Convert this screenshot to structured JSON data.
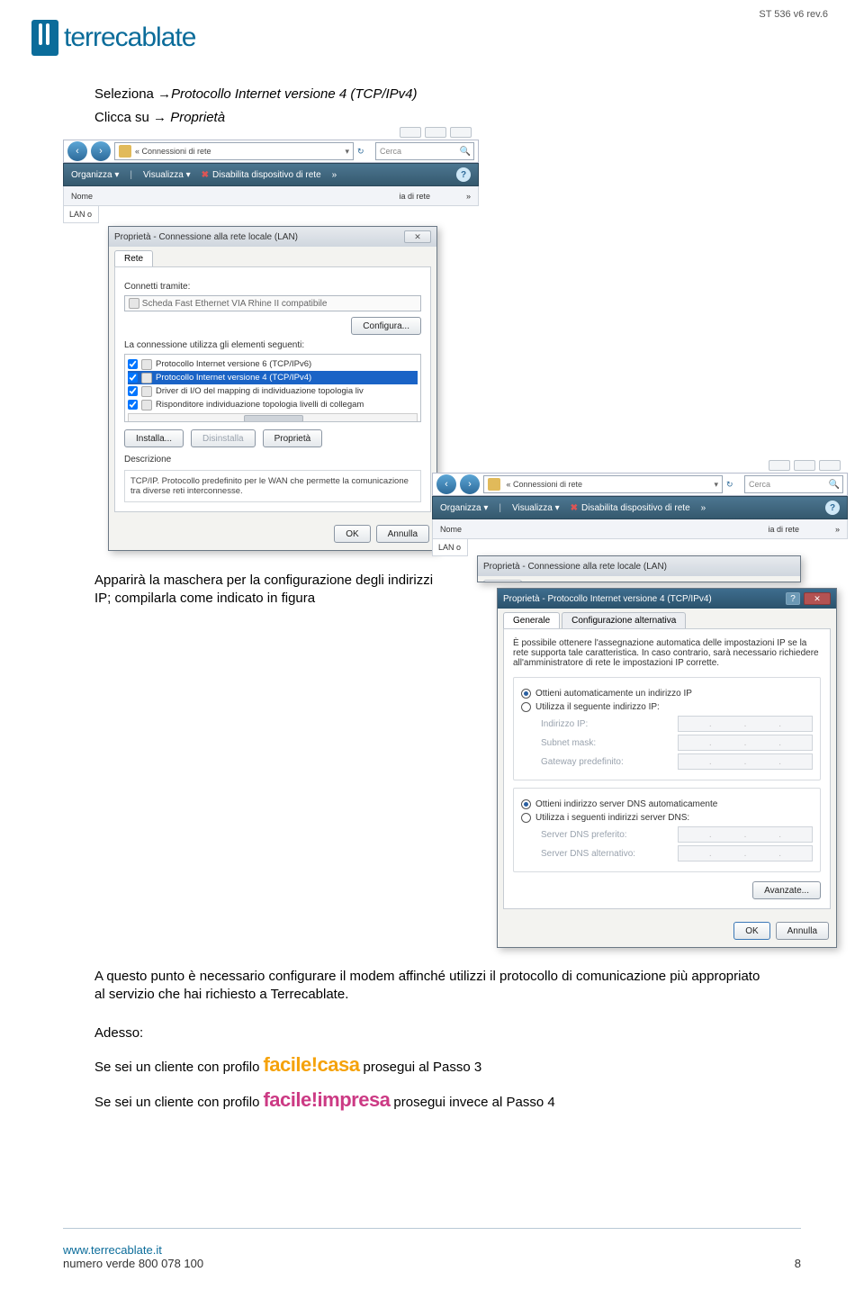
{
  "doc_id": "ST 536 v6 rev.6",
  "logo_text": "terrecablate",
  "instr1_a": "Seleziona ",
  "instr1_arrow": "→",
  "instr1_b": "Protocollo Internet versione 4 (TCP/IPv4)",
  "instr1_c": "Clicca su ",
  "instr1_d": " Proprietà",
  "para2": "Apparirà la maschera per la configurazione degli indirizzi IP; compilarla come indicato in figura",
  "para3": "A questo punto è necessario configurare il modem affinché utilizzi il protocollo di comunicazione più appropriato al servizio che hai richiesto a Terrecablate.",
  "adesso_hdr": "Adesso:",
  "prof1_a": "Se sei un cliente con profilo ",
  "prof1_brand": "facile!casa",
  "prof1_b": " prosegui al Passo 3",
  "prof2_a": "Se sei un cliente con profilo ",
  "prof2_brand": "facile!impresa",
  "prof2_b": " prosegui invece al Passo 4",
  "footer_link": "www.terrecablate.it",
  "footer_tel": "numero verde 800 078 100",
  "page_num": "8",
  "explorer": {
    "breadcrumb": "« Connessioni di rete",
    "search_ph": "Cerca",
    "org": {
      "organizza": "Organizza ▾",
      "visualizza": "Visualizza ▾",
      "disable": "Disabilita dispositivo di rete",
      "more": "»"
    },
    "nome": "Nome",
    "ia_rete": "ia di rete",
    "raquo": "»",
    "lan_o": "LAN o"
  },
  "dlg1": {
    "title": "Proprietà - Connessione alla rete locale (LAN)",
    "tab_rete": "Rete",
    "connetti": "Connetti tramite:",
    "adapter": "Scheda Fast Ethernet VIA Rhine II compatibile",
    "configura": "Configura...",
    "elementi": "La connessione utilizza gli elementi seguenti:",
    "items": [
      "Protocollo Internet versione 6 (TCP/IPv6)",
      "Protocollo Internet versione 4 (TCP/IPv4)",
      "Driver di I/O del mapping di individuazione topologia liv",
      "Risponditore individuazione topologia livelli di collegam"
    ],
    "installa": "Installa...",
    "disinstalla": "Disinstalla",
    "proprieta": "Proprietà",
    "desc_hdr": "Descrizione",
    "desc_txt": "TCP/IP. Protocollo predefinito per le WAN che permette la comunicazione tra diverse reti interconnesse.",
    "ok": "OK",
    "annulla": "Annulla"
  },
  "dlg2": {
    "title": "Proprietà - Protocollo Internet versione 4 (TCP/IPv4)",
    "tab_gen": "Generale",
    "tab_alt": "Configurazione alternativa",
    "blurb": "È possibile ottenere l'assegnazione automatica delle impostazioni IP se la rete supporta tale caratteristica. In caso contrario, sarà necessario richiedere all'amministratore di rete le impostazioni IP corrette.",
    "r1": "Ottieni automaticamente un indirizzo IP",
    "r2": "Utilizza il seguente indirizzo IP:",
    "ip_lbl": "Indirizzo IP:",
    "sn_lbl": "Subnet mask:",
    "gw_lbl": "Gateway predefinito:",
    "r3": "Ottieni indirizzo server DNS automaticamente",
    "r4": "Utilizza i seguenti indirizzi server DNS:",
    "dns1": "Server DNS preferito:",
    "dns2": "Server DNS alternativo:",
    "avanzate": "Avanzate...",
    "ok": "OK",
    "annulla": "Annulla"
  }
}
